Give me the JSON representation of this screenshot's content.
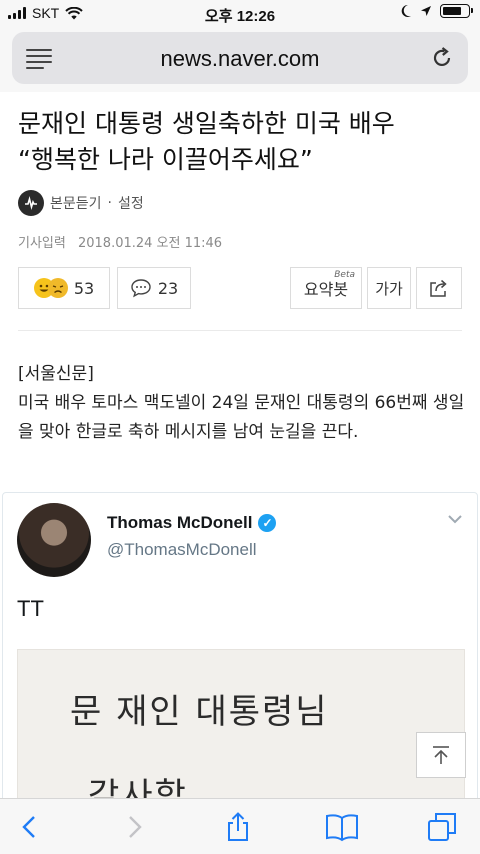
{
  "status_bar": {
    "carrier": "SKT",
    "time": "오후 12:26",
    "battery_level": 0.75
  },
  "browser": {
    "url_domain": "news.naver.com"
  },
  "article": {
    "headline_line1": "문재인 대통령 생일축하한 미국 배우",
    "headline_line2": "“행복한 나라 이끌어주세요”",
    "listen_label": "본문듣기",
    "separator": "·",
    "settings_label": "설정",
    "date_label": "기사입력",
    "date_value": "2018.01.24 오전 11:46",
    "reaction_count": "53",
    "comment_count": "23",
    "summary_label": "요약봇",
    "beta_label": "Beta",
    "font_size_label": "가가",
    "source": "[서울신문]",
    "lead_text": "미국 배우 토마스 맥도넬이 24일 문재인 대통령의 66번째 생일을 맞아 한글로 축하 메시지를 남여 눈길을 끈다."
  },
  "tweet": {
    "name": "Thomas McDonell",
    "verified_mark": "✓",
    "handle": "@ThomasMcDonell",
    "text": "TT",
    "handwriting_line1": "문 재인  대통령님",
    "handwriting_line2": "감사합"
  },
  "colors": {
    "twitter_blue": "#1da1f2",
    "ios_blue": "#1f7cf6",
    "emoji_yellow": "#f6c31b"
  },
  "icons": {
    "menu": "hamburger-icon",
    "reload": "reload-icon",
    "listen": "audio-icon",
    "comment": "speech-bubble-icon",
    "share": "share-icon",
    "scroll_top": "arrow-up-icon",
    "back": "chevron-left-icon",
    "forward": "chevron-right-icon",
    "bookmarks": "book-icon",
    "tabs": "tabs-icon"
  }
}
